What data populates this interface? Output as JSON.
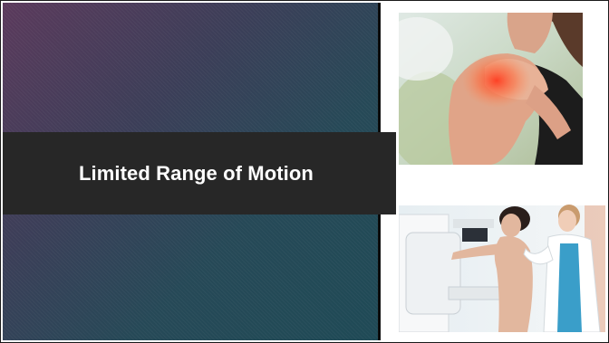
{
  "slide": {
    "title": "Limited Range of Motion",
    "images": [
      {
        "name": "shoulder-pain-photo",
        "alt": "Woman holding painful shoulder"
      },
      {
        "name": "mammography-photo",
        "alt": "Patient with technician at mammography machine"
      }
    ]
  },
  "colors": {
    "gradient_start": "#5b3a5c",
    "gradient_end": "#1f4a56",
    "title_band": "#272727",
    "title_text": "#ffffff",
    "pain_highlight": "#ff5a3c"
  }
}
